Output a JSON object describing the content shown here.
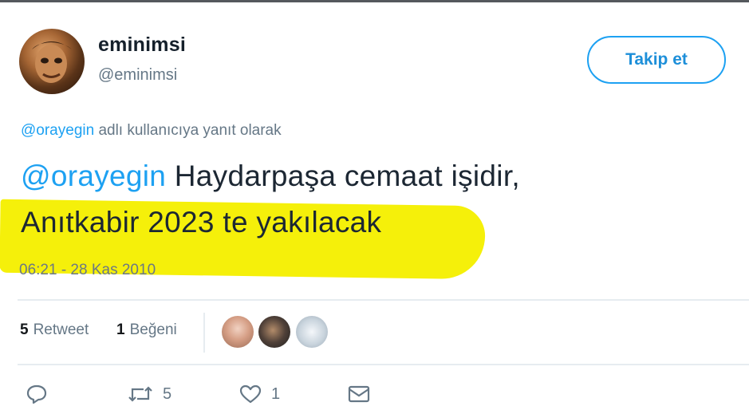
{
  "tweet": {
    "author": {
      "display_name": "eminimsi",
      "handle": "@eminimsi",
      "avatar_icon": "avatar-icon"
    },
    "follow_label": "Takip et",
    "reply_context": {
      "mention": "@orayegin",
      "text": " adlı kullanıcıya yanıt olarak"
    },
    "body": {
      "mention": "@orayegin",
      "line1_rest": " Haydarpaşa cemaat işidir,",
      "line2": "Anıtkabir 2023 te yakılacak"
    },
    "timestamp": "06:21 - 28 Kas 2010",
    "stats": {
      "retweet_count": "5",
      "retweet_label": "Retweet",
      "like_count": "1",
      "like_label": "Beğeni"
    },
    "actions": {
      "reply_icon": "reply-icon",
      "retweet_icon": "retweet-icon",
      "retweet_count": "5",
      "like_icon": "heart-icon",
      "like_count": "1",
      "dm_icon": "envelope-icon"
    }
  },
  "colors": {
    "accent": "#1da1f2",
    "text": "#14171a",
    "muted": "#657786",
    "highlight": "#f5f00a",
    "divider": "#e6ecf0"
  }
}
